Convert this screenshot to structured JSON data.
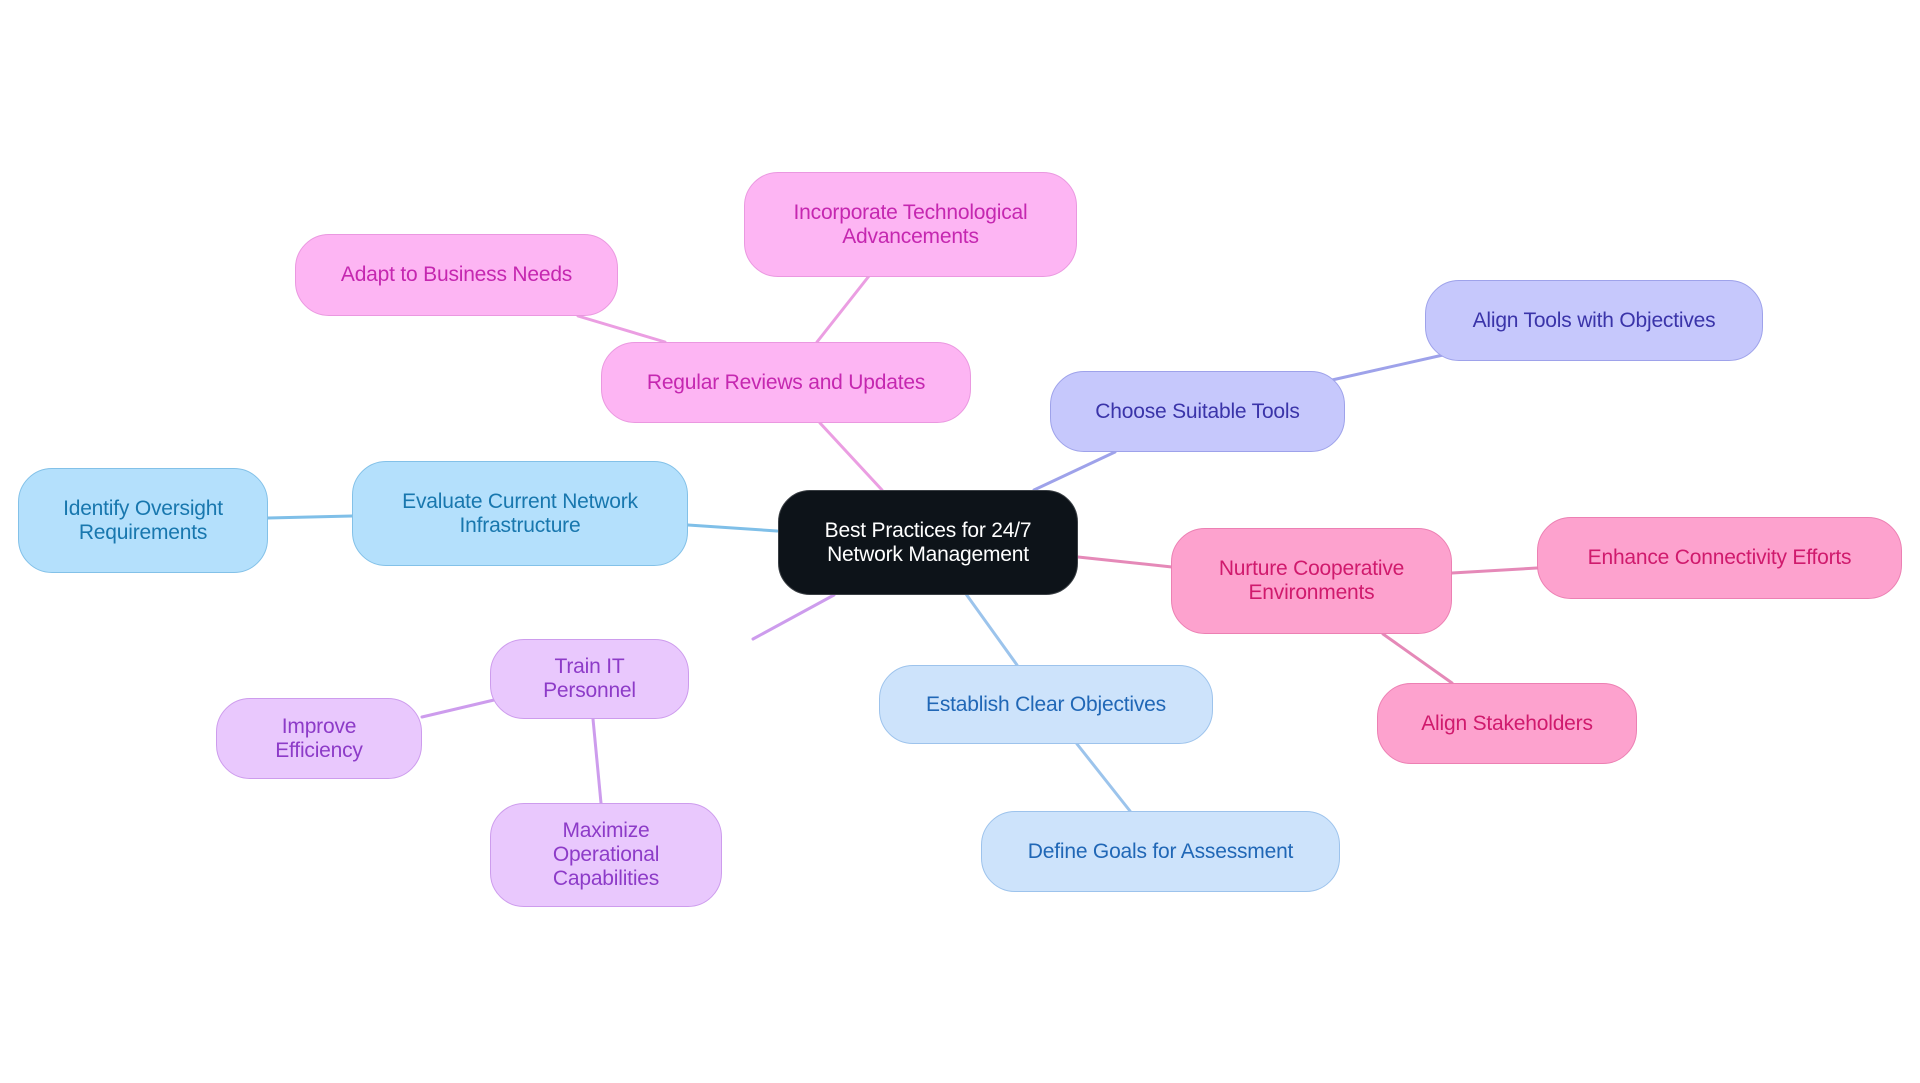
{
  "diagram": {
    "type": "mind-map",
    "root": {
      "id": "root",
      "label": "Best Practices for 24/7\nNetwork Management"
    },
    "branches": [
      {
        "id": "reviews",
        "label": "Regular Reviews and Updates",
        "color": "pink",
        "children": [
          {
            "id": "adapt",
            "label": "Adapt to Business Needs"
          },
          {
            "id": "incorporate",
            "label": "Incorporate Technological\nAdvancements"
          }
        ]
      },
      {
        "id": "tools",
        "label": "Choose Suitable Tools",
        "color": "lilac",
        "children": [
          {
            "id": "align-tools",
            "label": "Align Tools with Objectives"
          }
        ]
      },
      {
        "id": "nurture",
        "label": "Nurture Cooperative\nEnvironments",
        "color": "rose",
        "children": [
          {
            "id": "enhance",
            "label": "Enhance Connectivity Efforts"
          },
          {
            "id": "stakeholders",
            "label": "Align Stakeholders"
          }
        ]
      },
      {
        "id": "objectives",
        "label": "Establish Clear Objectives",
        "color": "sky",
        "children": [
          {
            "id": "define-goals",
            "label": "Define Goals for Assessment"
          }
        ]
      },
      {
        "id": "train",
        "label": "Train IT Personnel",
        "color": "purple",
        "children": [
          {
            "id": "efficiency",
            "label": "Improve Efficiency"
          },
          {
            "id": "maximize",
            "label": "Maximize Operational\nCapabilities"
          }
        ]
      },
      {
        "id": "evaluate",
        "label": "Evaluate Current Network\nInfrastructure",
        "color": "blue",
        "children": [
          {
            "id": "oversight",
            "label": "Identify Oversight\nRequirements"
          }
        ]
      }
    ]
  },
  "colors": {
    "root": "#0d1319",
    "pink": "#fdb5f3",
    "lilac": "#c6c8fc",
    "rose": "#fda2ce",
    "sky": "#cde3fb",
    "purple": "#e9c8fd",
    "blue": "#b4e0fc",
    "edge_pink": "#eb9ee2",
    "edge_lilac": "#9ea2ea",
    "edge_rose": "#e589b8",
    "edge_sky": "#9cc4ec",
    "edge_purple": "#cd9ced",
    "edge_blue": "#7fbfe8"
  }
}
